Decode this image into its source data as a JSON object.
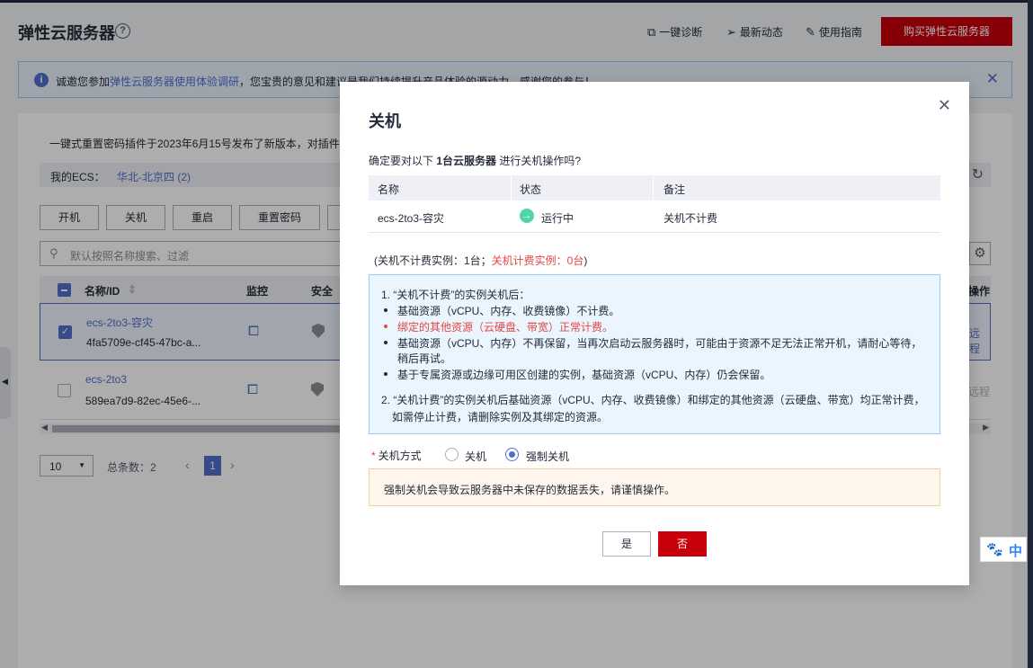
{
  "header": {
    "title": "弹性云服务器",
    "help_icon": "?",
    "links": [
      "一键诊断",
      "最新动态",
      "使用指南"
    ],
    "buy_button": "购买弹性云服务器"
  },
  "notice": {
    "prefix": "诚邀您参加",
    "link": "弹性云服务器使用体验调研",
    "suffix": "，您宝贵的意见和建议是我们持续提升产品体验的源动力，感谢您的参与！",
    "close": "✕"
  },
  "main": {
    "tip": "一键式重置密码插件于2023年6月15号发布了新版本，对插件",
    "region_label": "我的ECS：",
    "region_value": "华北-北京四 (2)",
    "actions": [
      "开机",
      "关机",
      "重启",
      "重置密码"
    ],
    "search_placeholder": "默认按照名称搜索、过滤",
    "columns": [
      "名称/ID",
      "监控",
      "安全",
      "操作"
    ],
    "rows": [
      {
        "name": "ecs-2to3-容灾",
        "id": "4fa5709e-cf45-47bc-a...",
        "action": "远程",
        "selected": true
      },
      {
        "name": "ecs-2to3",
        "id": "589ea7d9-82ec-45e6-...",
        "action": "远程",
        "selected": false
      }
    ],
    "pager": {
      "size": "10",
      "total": "总条数：2",
      "current": "1"
    }
  },
  "modal": {
    "title": "关机",
    "close": "✕",
    "question_prefix": "确定要对以下 ",
    "question_bold": "1台云服务器",
    "question_suffix": " 进行关机操作吗?",
    "table_headers": [
      "名称",
      "状态",
      "备注"
    ],
    "table_row": {
      "name": "ecs-2to3-容灾",
      "status": "运行中",
      "note": "关机不计费"
    },
    "count_prefix": "(关机不计费实例：1台；",
    "count_red": "关机计费实例：0台",
    "count_suffix": ")",
    "info": {
      "p1_title": "1. “关机不计费”的实例关机后：",
      "bullets": [
        "基础资源（vCPU、内存、收费镜像）不计费。",
        "绑定的其他资源（云硬盘、带宽）正常计费。",
        "基础资源（vCPU、内存）不再保留，当再次启动云服务器时，可能由于资源不足无法正常开机，请耐心等待，",
        "稍后再试。",
        "基于专属资源或边缘可用区创建的实例，基础资源（vCPU、内存）仍会保留。"
      ],
      "p2_line1": "2. “关机计费”的实例关机后基础资源（vCPU、内存、收费镜像）和绑定的其他资源（云硬盘、带宽）均正常计费，",
      "p2_line2": "如需停止计费，请删除实例及其绑定的资源。"
    },
    "mode_star": "*",
    "mode_label": "关机方式",
    "mode_options": [
      "关机",
      "强制关机"
    ],
    "mode_selected": "强制关机",
    "warning": "强制关机会导致云服务器中未保存的数据丢失，请谨慎操作。",
    "yes": "是",
    "no": "否"
  },
  "ime": {
    "paw": "🐾",
    "lang": "中"
  },
  "colors": {
    "brand": "#c7000b",
    "link": "#526ecc",
    "danger": "#e54545",
    "running": "#50d4ab"
  }
}
